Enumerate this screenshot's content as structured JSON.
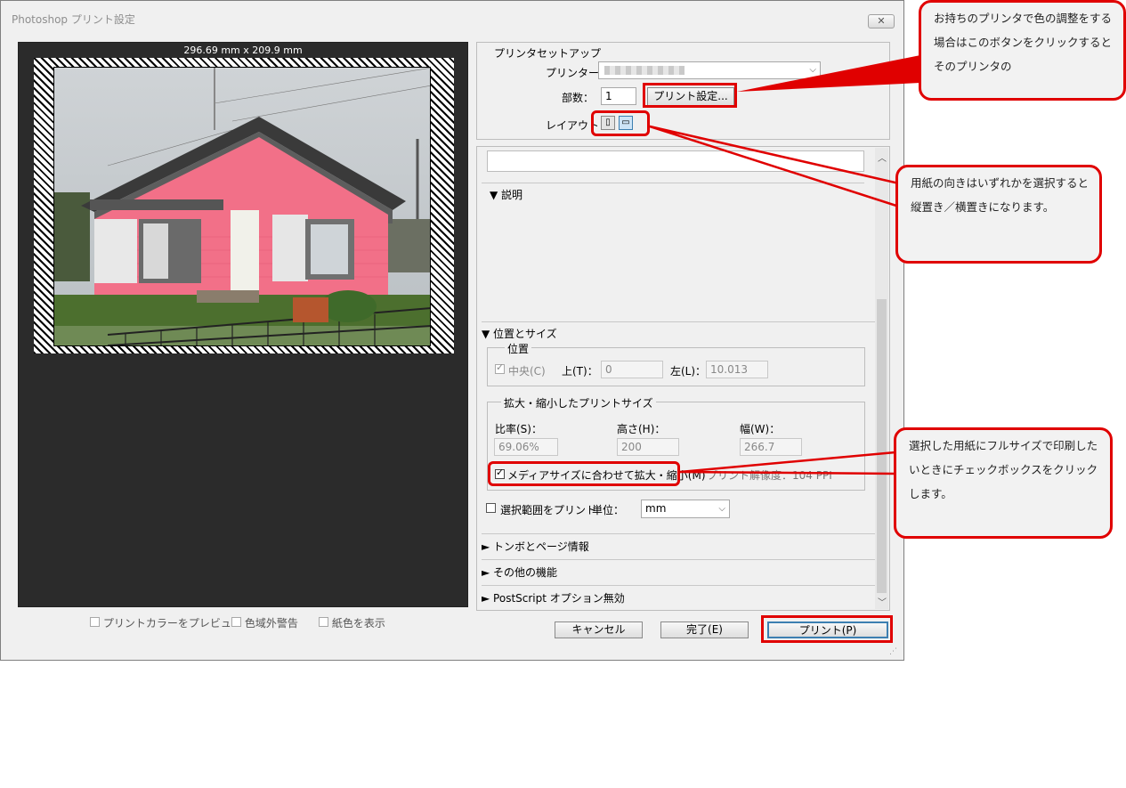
{
  "window": {
    "title": "Photoshop プリント設定",
    "close_glyph": "✕"
  },
  "preview": {
    "paper_size": "296.69 mm x 209.9 mm",
    "options": [
      {
        "label": "プリントカラーをプレビュー",
        "checked": false
      },
      {
        "label": "色域外警告",
        "checked": false
      },
      {
        "label": "紙色を表示",
        "checked": false
      }
    ]
  },
  "printer_setup": {
    "group_label": "プリンタセットアップ",
    "printer_label": "プリンター：",
    "copies_label": "部数：",
    "copies_value": "1",
    "print_settings_button": "プリント設定...",
    "layout_label": "レイアウト："
  },
  "description": {
    "header": "▼ 説明"
  },
  "position_size": {
    "header": "▼ 位置とサイズ",
    "position_group": "位置",
    "center_label": "中央(C)",
    "center_checked": true,
    "top_label": "上(T)：",
    "top_value": "0",
    "left_label": "左(L)：",
    "left_value": "10.013",
    "scaled_group": "拡大・縮小したプリントサイズ",
    "scale_label": "比率(S)：",
    "scale_value": "69.06%",
    "height_label": "高さ(H)：",
    "height_value": "200",
    "width_label": "幅(W)：",
    "width_value": "266.7",
    "fit_media_label": "メディアサイズに合わせて拡大・縮小(M)",
    "fit_media_checked": true,
    "resolution_text": "プリント解像度：104 PPI",
    "print_selection_label": "選択範囲をプリント",
    "units_label": "単位：",
    "units_value": "mm"
  },
  "collapsed_sections": [
    {
      "label": "► トンボとページ情報"
    },
    {
      "label": "► その他の機能"
    },
    {
      "label": "► PostScript オプション無効"
    }
  ],
  "buttons": {
    "cancel": "キャンセル",
    "done": "完了(E)",
    "print": "プリント(P)"
  },
  "callouts": {
    "printer_color": "お持ちのプリンタで色の調整をする場合はこのボタンをクリックするとそのプリンタの",
    "orientation": "用紙の向きはいずれかを選択すると縦置き／横置きになります。",
    "full_size": "選択した用紙にフルサイズで印刷したいときにチェックボックスをクリックします。"
  },
  "colors": {
    "accent": "#e00000",
    "dialog_bg": "#f0f0f0",
    "preview_bg": "#2b2b2b",
    "house_pink": "#f27088"
  }
}
